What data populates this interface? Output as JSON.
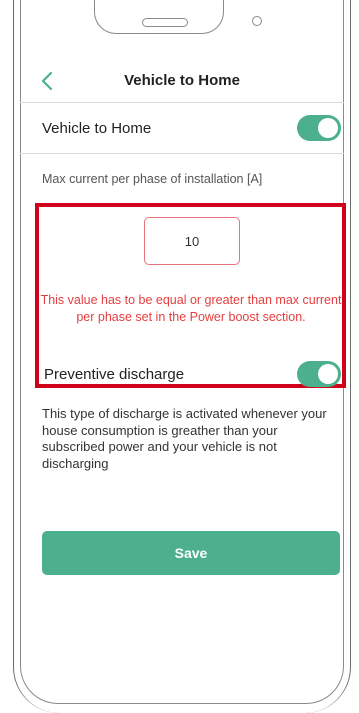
{
  "header": {
    "title": "Vehicle to Home",
    "back_icon": "chevron-left-icon"
  },
  "vehicle_to_home": {
    "label": "Vehicle to Home",
    "enabled": true
  },
  "max_current": {
    "label": "Max current per phase of installation [A]",
    "value": "10"
  },
  "error_message": "This value has to be equal or greater than max current per phase set in the Power boost section.",
  "preventive_discharge": {
    "label": "Preventive discharge",
    "enabled": true,
    "description": "This type of discharge is activated whenever your house consumption is greather than your subscribed power and your vehicle is not discharging"
  },
  "save_label": "Save",
  "colors": {
    "accent": "#4caf8e",
    "error": "#e53e3e",
    "highlight": "#d0021b"
  }
}
